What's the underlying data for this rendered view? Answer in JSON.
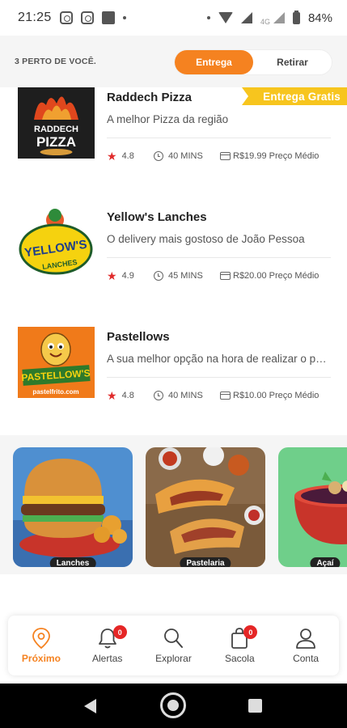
{
  "status_bar": {
    "time": "21:25",
    "network": "4G",
    "battery": "84%"
  },
  "header": {
    "nearby_label": "3 PERTO DE VOCÊ.",
    "toggle": {
      "delivery": "Entrega",
      "pickup": "Retirar",
      "selected": "Entrega"
    }
  },
  "colors": {
    "accent": "#f58220",
    "badge": "#f7c51e",
    "star": "#e02b2b",
    "notification": "#e52626"
  },
  "restaurants": [
    {
      "name": "Raddech Pizza",
      "description": "A melhor Pizza da região",
      "rating": "4.8",
      "time": "40 MINS",
      "price": "R$19.99 Preço Médio",
      "badge": "Entrega Gratis",
      "logo_text": [
        "RADDECH",
        "PIZZA"
      ]
    },
    {
      "name": "Yellow's Lanches",
      "description": "O delivery mais gostoso de João Pessoa",
      "rating": "4.9",
      "time": "45 MINS",
      "price": "R$20.00 Preço Médio",
      "logo_text": [
        "YELLOW'S",
        "LANCHES"
      ]
    },
    {
      "name": "Pastellows",
      "description": "A sua melhor opção na hora de realizar o pedido",
      "rating": "4.8",
      "time": "40 MINS",
      "price": "R$10.00 Preço Médio",
      "logo_text": [
        "PASTELLOW'S",
        "pastelfrito.com"
      ]
    }
  ],
  "categories": [
    {
      "label": "Lanches"
    },
    {
      "label": "Pastelaria"
    },
    {
      "label": "Açaí"
    }
  ],
  "bottom_nav": [
    {
      "label": "Próximo",
      "icon": "location-pin-icon",
      "active": true
    },
    {
      "label": "Alertas",
      "icon": "bell-icon",
      "badge": "0"
    },
    {
      "label": "Explorar",
      "icon": "search-icon"
    },
    {
      "label": "Sacola",
      "icon": "shopping-bag-icon",
      "badge": "0"
    },
    {
      "label": "Conta",
      "icon": "user-icon"
    }
  ]
}
